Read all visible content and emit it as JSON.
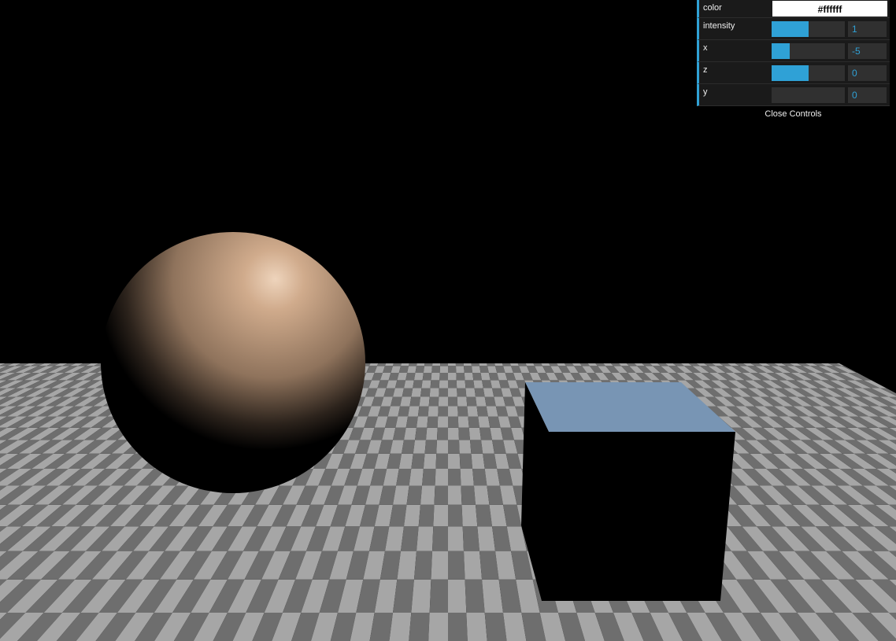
{
  "scene": {
    "background_color": "#000000",
    "floor": {
      "light_tile": "#a6a6a6",
      "dark_tile": "#6e6e6e"
    },
    "sphere": {
      "color": "#c9a383",
      "highlight": "#eed4bc"
    },
    "cube": {
      "top_color": "#7895b4",
      "side_color": "#000000"
    }
  },
  "controls": {
    "color": {
      "label": "color",
      "value": "#ffffff"
    },
    "intensity": {
      "label": "intensity",
      "value": "1",
      "fill": 0.5
    },
    "x": {
      "label": "x",
      "value": "-5",
      "fill": 0.25
    },
    "z": {
      "label": "z",
      "value": "0",
      "fill": 0.5
    },
    "y": {
      "label": "y",
      "value": "0",
      "fill": 0.0
    },
    "close_label": "Close Controls"
  },
  "accent_color": "#2fa1d6"
}
